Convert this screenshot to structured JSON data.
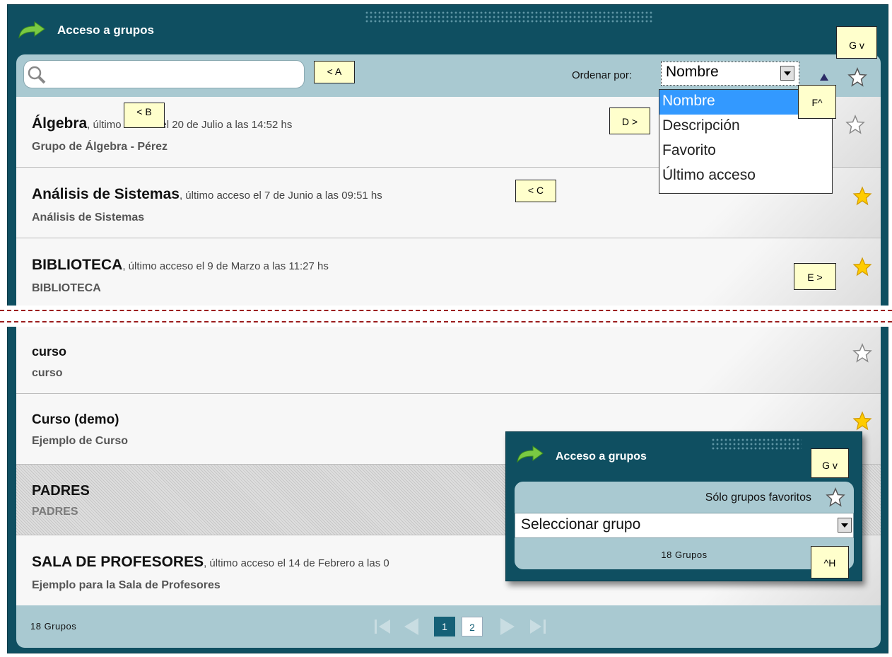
{
  "header": {
    "title": "Acceso a grupos"
  },
  "toolbar": {
    "search_placeholder": "",
    "sort_label": "Ordenar por:",
    "sort_selected": "Nombre",
    "sort_direction_icon": "ascending-triangle-icon",
    "favorites_icon": "star-outline-icon"
  },
  "sort_options": [
    "Nombre",
    "Descripción",
    "Favorito",
    "Último acceso"
  ],
  "rows": [
    {
      "name": "Álgebra",
      "access": ", último acceso el 20 de Julio a las 14:52 hs",
      "desc": "Grupo de Álgebra - Pérez",
      "favorite": false
    },
    {
      "name": "Análisis de Sistemas",
      "access": ", último acceso el 7 de Junio a las 09:51 hs",
      "desc": "Análisis de Sistemas",
      "favorite": true
    },
    {
      "name": "BIBLIOTECA",
      "access": ", último acceso el 9 de Marzo a las 11:27 hs",
      "desc": "BIBLIOTECA",
      "favorite": true
    },
    {
      "name": "curso",
      "access": "",
      "desc": "curso",
      "favorite": false
    },
    {
      "name": "Curso (demo)",
      "access": "",
      "desc": "Ejemplo de Curso",
      "favorite": true
    },
    {
      "name": "PADRES",
      "access": "",
      "desc": "PADRES",
      "favorite": false
    },
    {
      "name": "SALA DE PROFESORES",
      "access": ", último acceso el 14 de Febrero a las 0",
      "desc": "Ejemplo para la Sala de Profesores",
      "favorite": false
    }
  ],
  "footer": {
    "count": "18 Grupos",
    "pages": [
      "1",
      "2"
    ],
    "current_page": "1"
  },
  "callouts": {
    "a": "< A",
    "b": "< B",
    "c": "< C",
    "d": "D >",
    "e": "E >",
    "f": "F^",
    "g": "G v",
    "g2": "G v",
    "h": "^H"
  },
  "widget": {
    "title": "Acceso a grupos",
    "favorites_label": "Sólo grupos favoritos",
    "select_value": "Seleccionar grupo",
    "count": "18 Grupos"
  },
  "colors": {
    "frame": "#0f4f61",
    "panel": "#a9c9d1",
    "accent": "#3399ff",
    "star_fill": "#ffcc00"
  }
}
